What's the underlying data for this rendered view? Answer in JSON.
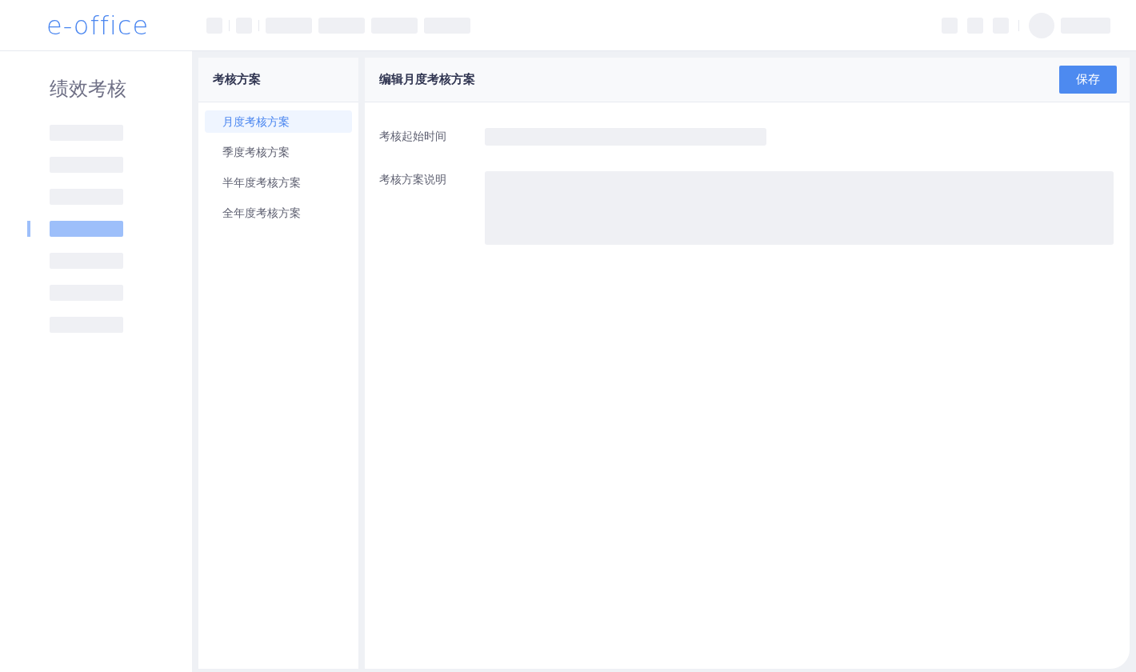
{
  "header": {
    "logo": "e-office"
  },
  "sidebar": {
    "title": "绩效考核",
    "items": [
      {
        "selected": false
      },
      {
        "selected": false
      },
      {
        "selected": false
      },
      {
        "selected": true
      },
      {
        "selected": false
      },
      {
        "selected": false
      },
      {
        "selected": false
      }
    ]
  },
  "plans": {
    "title": "考核方案",
    "items": [
      {
        "label": "月度考核方案",
        "selected": true
      },
      {
        "label": "季度考核方案",
        "selected": false
      },
      {
        "label": "半年度考核方案",
        "selected": false
      },
      {
        "label": "全年度考核方案",
        "selected": false
      }
    ]
  },
  "editor": {
    "title": "编辑月度考核方案",
    "save_button": "保存",
    "fields": [
      {
        "label": "考核起始时间",
        "kind": "input"
      },
      {
        "label": "考核方案说明",
        "kind": "textarea"
      }
    ]
  }
}
